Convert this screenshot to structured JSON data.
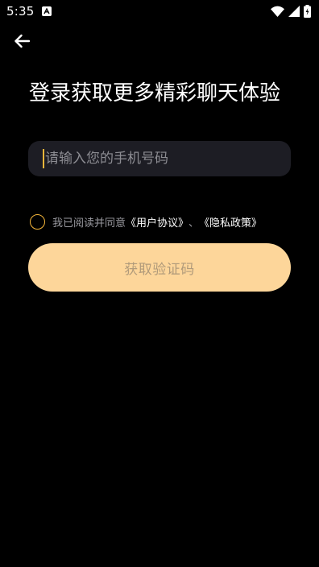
{
  "status_bar": {
    "time": "5:35",
    "icons": [
      "app-notification-icon",
      "wifi-icon",
      "cellular-signal-icon",
      "battery-icon"
    ]
  },
  "header": {
    "back_icon": "arrow-left-icon"
  },
  "title": "登录获取更多精彩聊天体验",
  "phone": {
    "placeholder": "请输入您的手机号码",
    "value": ""
  },
  "agreement": {
    "checked": false,
    "prefix": "我已阅读并同意",
    "user_agreement": "《用户协议》",
    "separator": "、",
    "privacy_policy": "《隐私政策》"
  },
  "get_code_button": {
    "label": "获取验证码"
  },
  "colors": {
    "background": "#000000",
    "accent": "#f5b63a",
    "button_bg": "#fdd69a",
    "button_text": "#b09a7a",
    "input_bg": "#1d1d24",
    "muted_text": "#9a9aa0"
  }
}
